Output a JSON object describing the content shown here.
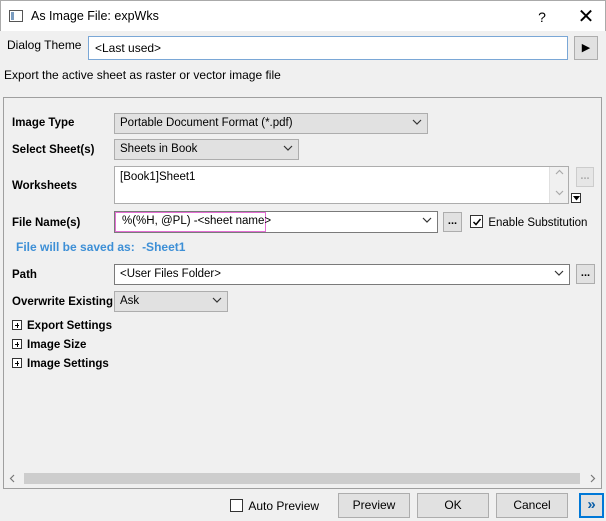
{
  "window": {
    "title": "As Image File: expWks",
    "help_glyph": "?",
    "close_glyph": "✕"
  },
  "theme": {
    "label": "Dialog Theme",
    "value": "<Last used>",
    "arrow_glyph": "▶"
  },
  "description": "Export the active sheet as raster or vector image file",
  "fields": {
    "image_type": {
      "label": "Image Type",
      "value": "Portable Document Format (*.pdf)"
    },
    "select_sheets": {
      "label": "Select Sheet(s)",
      "value": "Sheets in Book"
    },
    "worksheets": {
      "label": "Worksheets",
      "value": "[Book1]Sheet1",
      "dots": "..."
    },
    "file_names": {
      "label": "File Name(s)",
      "value": "%(%H, @PL) -<sheet name>",
      "dots": "...",
      "substitution_label": "Enable Substitution",
      "substitution_checked": true
    },
    "saved_as": {
      "prefix": "File will be saved as:",
      "value": "-Sheet1"
    },
    "path": {
      "label": "Path",
      "value": "<User Files Folder>",
      "dots": "..."
    },
    "overwrite": {
      "label": "Overwrite Existing",
      "value": "Ask"
    }
  },
  "sections": [
    {
      "label": "Export Settings"
    },
    {
      "label": "Image Size"
    },
    {
      "label": "Image Settings"
    }
  ],
  "footer": {
    "auto_preview_label": "Auto Preview",
    "auto_preview_checked": false,
    "preview_label": "Preview",
    "ok_label": "OK",
    "cancel_label": "Cancel",
    "more_glyph": "»"
  },
  "colors": {
    "accent": "#0078d7",
    "saved_as_text": "#3d8fd6",
    "filename_border": "#e36fd4"
  }
}
